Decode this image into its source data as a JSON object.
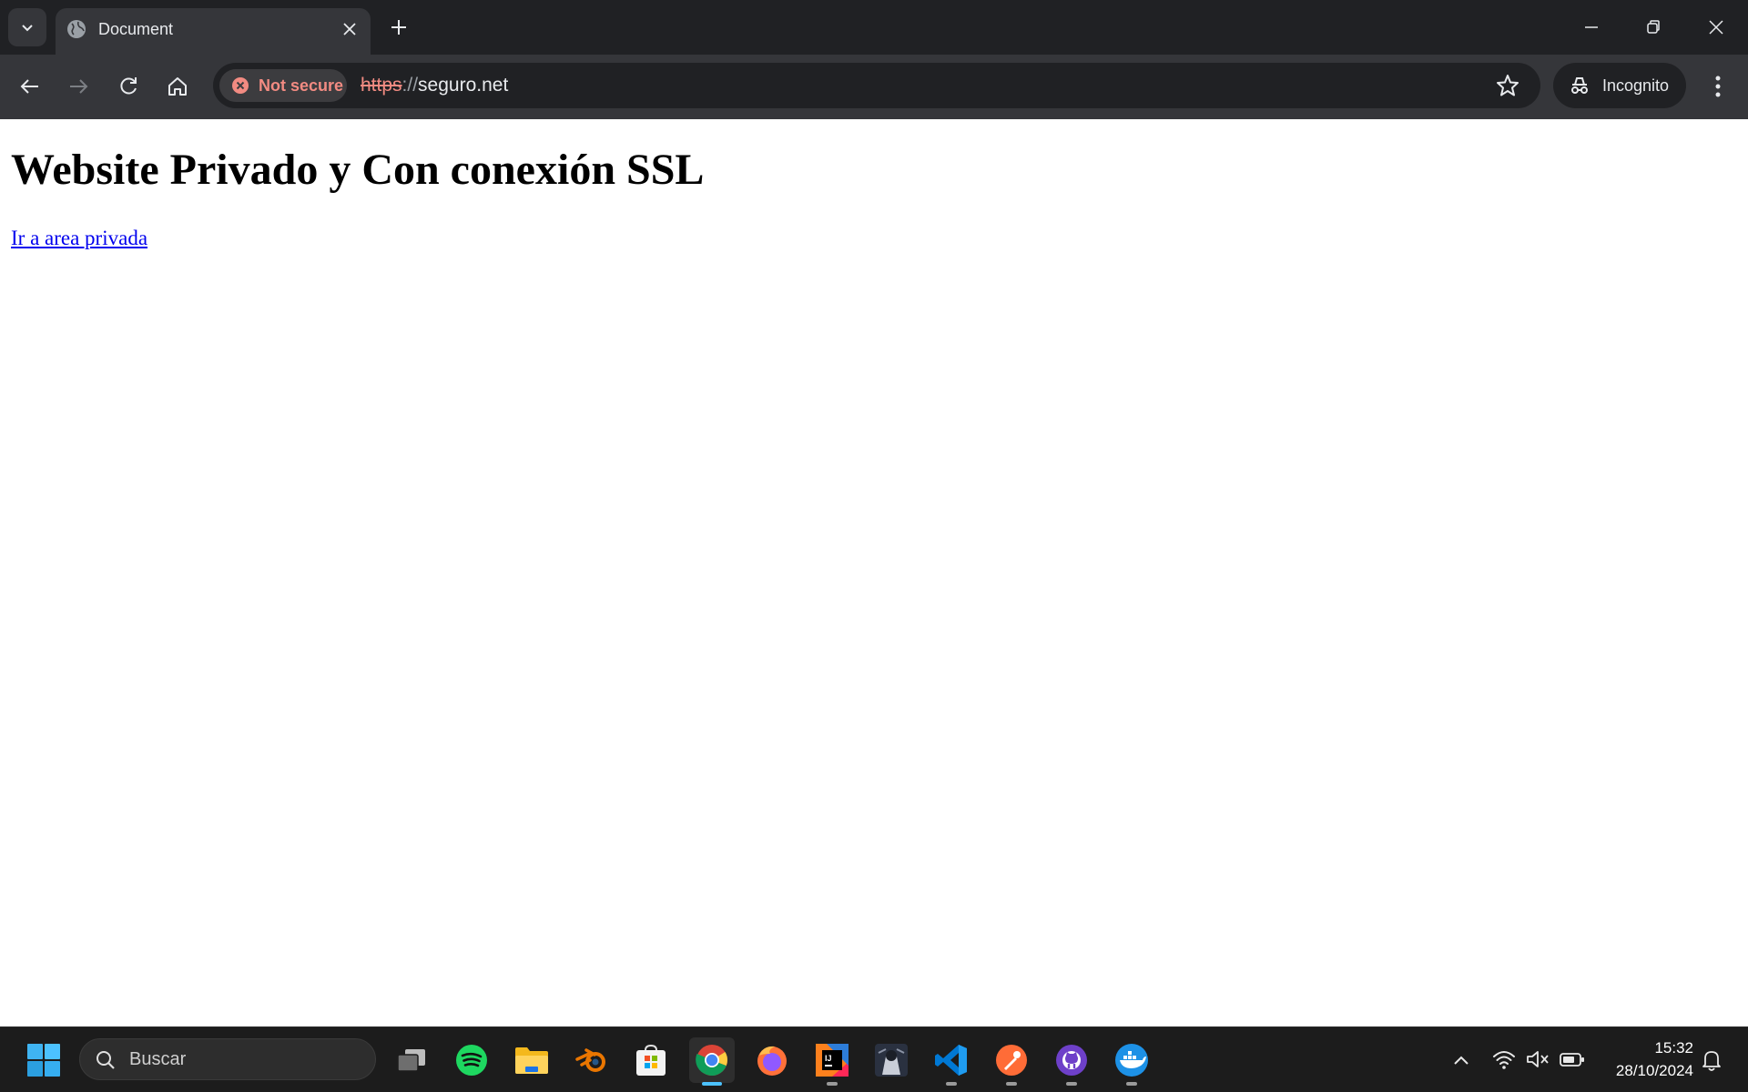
{
  "browser": {
    "tab": {
      "title": "Document"
    },
    "omnibox": {
      "security_label": "Not secure",
      "url_scheme": "https",
      "url_separator": "://",
      "url_host": "seguro.net"
    },
    "incognito_label": "Incognito",
    "colors": {
      "insecure": "#f28b82",
      "chrome_dark": "#202124",
      "chrome_mid": "#35363a"
    }
  },
  "page": {
    "heading": "Website Privado y Con conexión SSL",
    "link_text": "Ir a area privada",
    "link_color": "#0000ee"
  },
  "taskbar": {
    "search_placeholder": "Buscar",
    "apps": [
      "task-view",
      "spotify",
      "file-explorer",
      "blender",
      "microsoft-store",
      "chrome",
      "firefox",
      "intellij-idea",
      "game",
      "vs-code",
      "postman",
      "github-desktop",
      "docker"
    ],
    "active_app": "chrome",
    "clock": {
      "time": "15:32",
      "date": "28/10/2024"
    },
    "accent": "#4cc2ff"
  }
}
